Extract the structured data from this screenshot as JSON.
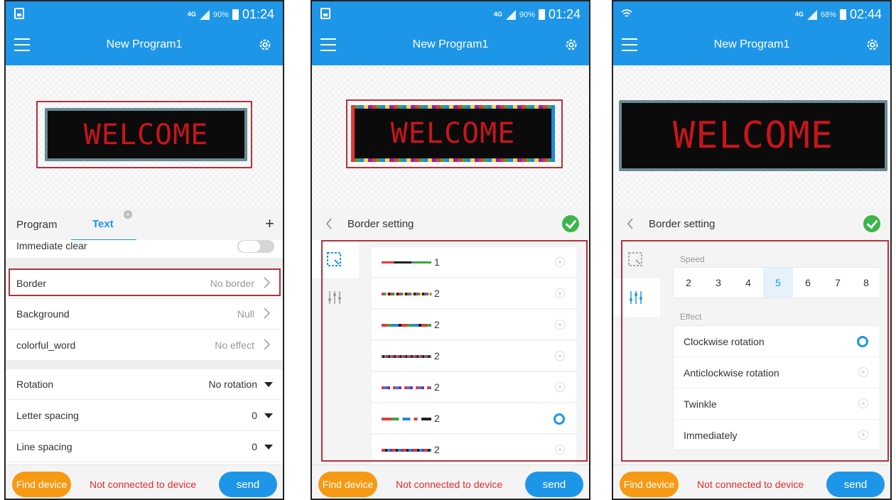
{
  "colors": {
    "accent": "#1e96e8",
    "find_button": "#f59a12",
    "error_text": "#e42b2b",
    "highlight": "#b5313b",
    "led_text": "#c8151b",
    "confirm": "#3cb54a"
  },
  "common": {
    "app_title": "New Program1",
    "led_text": "WELCOME",
    "find_device": "Find device",
    "connection_status": "Not connected to device",
    "send": "send",
    "network": "4G"
  },
  "phones": [
    {
      "battery": "90%",
      "time": "01:24"
    },
    {
      "battery": "90%",
      "time": "01:24"
    },
    {
      "battery": "68%",
      "time": "02:44"
    }
  ],
  "screen1": {
    "tabs": {
      "program": "Program",
      "text": "Text"
    },
    "immediate_clear": "Immediate clear",
    "rows": [
      {
        "label": "Border",
        "value": "No border"
      },
      {
        "label": "Background",
        "value": "Null"
      },
      {
        "label": "colorful_word",
        "value": "No effect"
      }
    ],
    "dropdowns": [
      {
        "label": "Rotation",
        "value": "No rotation"
      },
      {
        "label": "Letter spacing",
        "value": "0"
      },
      {
        "label": "Line spacing",
        "value": "0"
      }
    ]
  },
  "screen2": {
    "header": "Border setting",
    "borders": [
      {
        "label": "1",
        "selected": false
      },
      {
        "label": "2",
        "selected": false
      },
      {
        "label": "2",
        "selected": false
      },
      {
        "label": "2",
        "selected": false
      },
      {
        "label": "2",
        "selected": false
      },
      {
        "label": "2",
        "selected": true
      },
      {
        "label": "2",
        "selected": false
      }
    ]
  },
  "screen3": {
    "header": "Border setting",
    "speed_label": "Speed",
    "speeds": [
      "2",
      "3",
      "4",
      "5",
      "6",
      "7",
      "8"
    ],
    "selected_speed": "5",
    "effect_label": "Effect",
    "effects": [
      {
        "label": "Clockwise rotation",
        "selected": true
      },
      {
        "label": "Anticlockwise rotation",
        "selected": false
      },
      {
        "label": "Twinkle",
        "selected": false
      },
      {
        "label": "Immediately",
        "selected": false
      }
    ]
  }
}
